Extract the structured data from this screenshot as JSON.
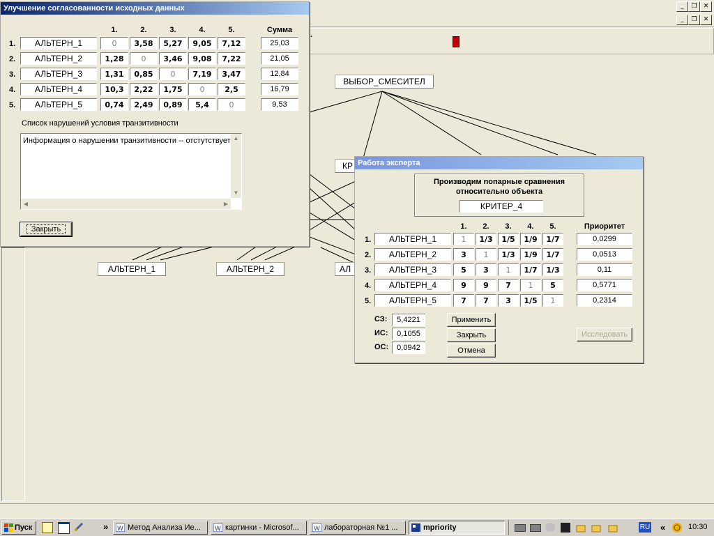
{
  "app": {
    "window_buttons_top": [
      "_",
      "❒",
      "✕"
    ],
    "window_buttons_child": [
      "_",
      "❒",
      "✕"
    ],
    "toolbar_extra_text": "·"
  },
  "hierarchy": {
    "root": "ВЫБОР_СМЕСИТЕЛ",
    "criterion_partial": "КР",
    "alt1": "АЛЬТЕРН_1",
    "alt2": "АЛЬТЕРН_2",
    "alt3_partial": "АЛ"
  },
  "consistency_dialog": {
    "title": "Улучшение согласованности исходных данных",
    "col_headers": [
      "1.",
      "2.",
      "3.",
      "4.",
      "5."
    ],
    "sum_header": "Сумма",
    "rows": [
      {
        "num": "1.",
        "name": "АЛЬТЕРН_1",
        "values": [
          "0",
          "3,58",
          "5,27",
          "9,05",
          "7,12"
        ],
        "sum": "25,03"
      },
      {
        "num": "2.",
        "name": "АЛЬТЕРН_2",
        "values": [
          "1,28",
          "0",
          "3,46",
          "9,08",
          "7,22"
        ],
        "sum": "21,05"
      },
      {
        "num": "3.",
        "name": "АЛЬТЕРН_3",
        "values": [
          "1,31",
          "0,85",
          "0",
          "7,19",
          "3,47"
        ],
        "sum": "12,84"
      },
      {
        "num": "4.",
        "name": "АЛЬТЕРН_4",
        "values": [
          "10,3",
          "2,22",
          "1,75",
          "0",
          "2,5"
        ],
        "sum": "16,79"
      },
      {
        "num": "5.",
        "name": "АЛЬТЕРН_5",
        "values": [
          "0,74",
          "2,49",
          "0,89",
          "5,4",
          "0"
        ],
        "sum": "9,53"
      }
    ],
    "violations_label": "Список нарушений условия транзитивности",
    "violations_text": "Информация о нарушении транзитивности -- отстутствует!",
    "close_button": "Закрыть"
  },
  "expert_dialog": {
    "title": "Работа эксперта",
    "header_line1": "Производим попарные сравнения",
    "header_line2": "относительно объекта",
    "object": "КРИТЕР_4",
    "col_headers": [
      "1.",
      "2.",
      "3.",
      "4.",
      "5."
    ],
    "priority_header": "Приоритет",
    "rows": [
      {
        "num": "1.",
        "name": "АЛЬТЕРН_1",
        "values": [
          "1",
          "1/3",
          "1/5",
          "1/9",
          "1/7"
        ],
        "priority": "0,0299"
      },
      {
        "num": "2.",
        "name": "АЛЬТЕРН_2",
        "values": [
          "3",
          "1",
          "1/3",
          "1/9",
          "1/7"
        ],
        "priority": "0,0513"
      },
      {
        "num": "3.",
        "name": "АЛЬТЕРН_3",
        "values": [
          "5",
          "3",
          "1",
          "1/7",
          "1/3"
        ],
        "priority": "0,11"
      },
      {
        "num": "4.",
        "name": "АЛЬТЕРН_4",
        "values": [
          "9",
          "9",
          "7",
          "1",
          "5"
        ],
        "priority": "0,5771"
      },
      {
        "num": "5.",
        "name": "АЛЬТЕРН_5",
        "values": [
          "7",
          "7",
          "3",
          "1/5",
          "1"
        ],
        "priority": "0,2314"
      }
    ],
    "sz_label": "СЗ:",
    "sz_value": "5,4221",
    "is_label": "ИС:",
    "is_value": "0,1055",
    "os_label": "ОС:",
    "os_value": "0,0942",
    "apply_button": "Применить",
    "close_button": "Закрыть",
    "cancel_button": "Отмена",
    "research_button": "Исследовать"
  },
  "taskbar": {
    "start": "Пуск",
    "overflow": "»",
    "tasks": [
      {
        "label": "Метод Анализа Ие...",
        "active": false
      },
      {
        "label": "картинки - Microsof...",
        "active": false
      },
      {
        "label": "лабораторная №1 ...",
        "active": false
      },
      {
        "label": "mpriority",
        "active": true
      }
    ],
    "lang": "RU",
    "tray_overflow": "«",
    "clock": "10:30"
  }
}
